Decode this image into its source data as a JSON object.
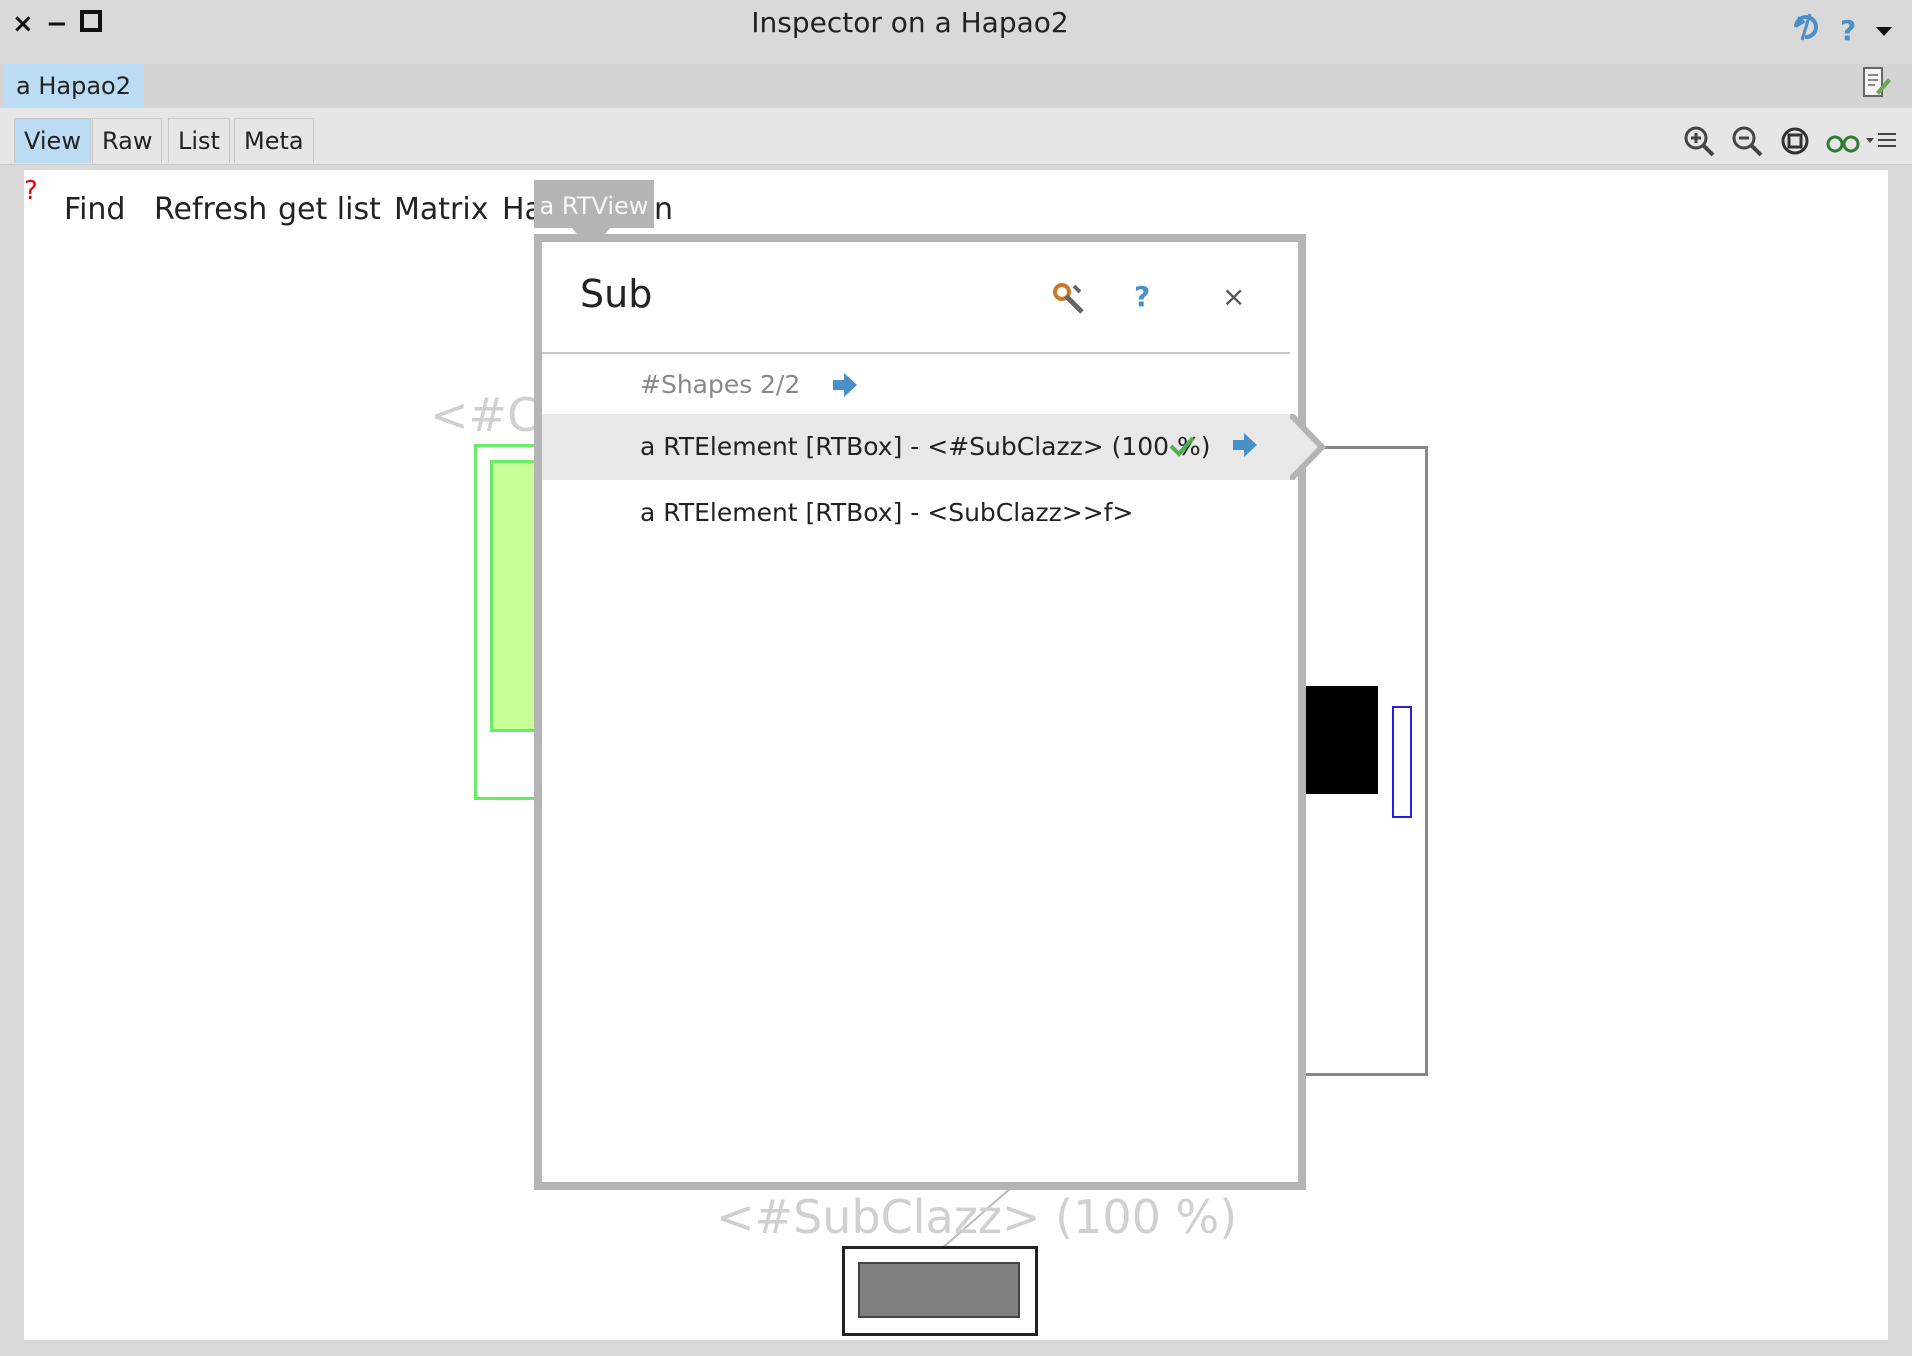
{
  "window": {
    "title": "Inspector on a Hapao2",
    "close_glyph": "×",
    "minimize_glyph": "−",
    "maximize_glyph": "□",
    "help_glyph": "?"
  },
  "object_tab": {
    "label": "a Hapao2"
  },
  "view_tabs": [
    {
      "label": "View"
    },
    {
      "label": "Raw"
    },
    {
      "label": "List"
    },
    {
      "label": "Meta"
    }
  ],
  "canvas_menu": {
    "error_mark": "?",
    "items": [
      {
        "label": "Find"
      },
      {
        "label": "Refresh"
      },
      {
        "label": "get list"
      },
      {
        "label": "Matrix"
      },
      {
        "label": "Ha"
      },
      {
        "label": "n"
      }
    ]
  },
  "popover": {
    "pointer_label": "a RTView",
    "title": "Sub",
    "help_glyph": "?",
    "close_glyph": "×",
    "shapes_label": "#Shapes",
    "shapes_count": "2/2",
    "rows": [
      {
        "text": "a RTElement [RTBox] - <#SubClazz> (100 %)"
      },
      {
        "text": "a RTElement [RTBox] - <SubClazz>>f>"
      }
    ]
  },
  "canvas_labels": {
    "faint_top": "<#Cl",
    "faint_bottom": "<#SubClazz> (100 %)"
  },
  "colors": {
    "accent_tab": "#bcdcf4",
    "icon_blue": "#4a90c8",
    "green_box": "#c8ff96",
    "green_border": "#66ee66",
    "error_red": "#ee0000"
  }
}
